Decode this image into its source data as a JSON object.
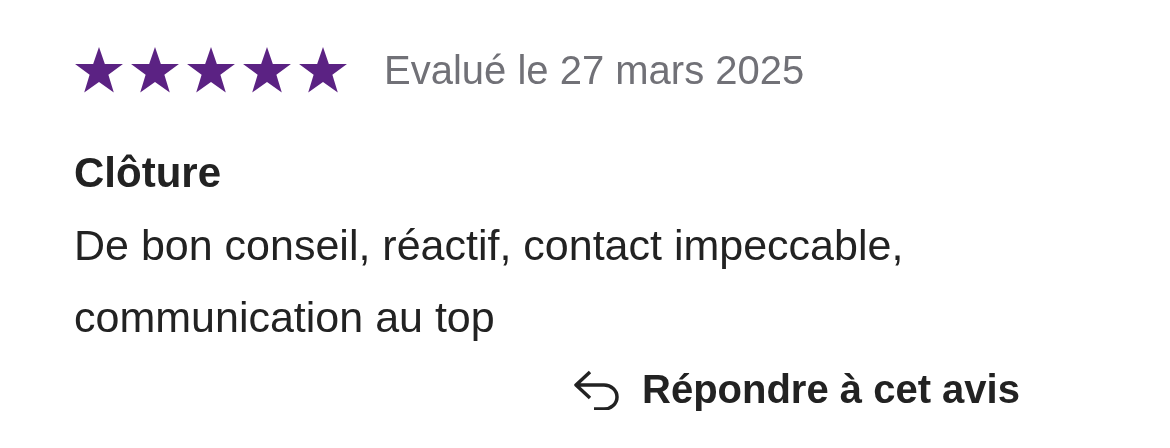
{
  "review": {
    "stars": 5,
    "date": "Evalué le 27 mars 2025",
    "title": "Clôture",
    "body": "De bon conseil, réactif, contact impeccable, communication au top"
  },
  "reply_button": {
    "label": "Répondre à cet avis"
  }
}
